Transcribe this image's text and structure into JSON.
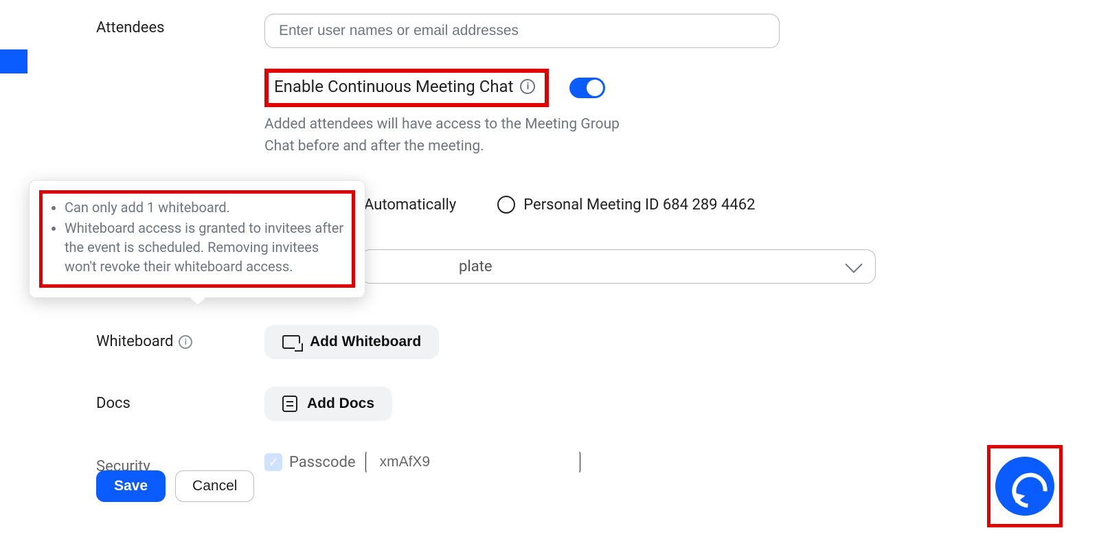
{
  "attendees": {
    "label": "Attendees",
    "placeholder": "Enter user names or email addresses"
  },
  "continuous_chat": {
    "title": "Enable Continuous Meeting Chat",
    "description": "Added attendees will have access to the Meeting Group Chat before and after the meeting.",
    "enabled": true
  },
  "meeting_id": {
    "auto_label_partial": "Automatically",
    "personal_label": "Personal Meeting ID 684 289 4462"
  },
  "template": {
    "selected_partial": "plate"
  },
  "whiteboard": {
    "label": "Whiteboard",
    "button": "Add Whiteboard",
    "tooltip_bullets": [
      "Can only add 1 whiteboard.",
      "Whiteboard access is granted to invitees after the event is scheduled. Removing invitees won't revoke their whiteboard access."
    ]
  },
  "docs": {
    "label": "Docs",
    "button": "Add Docs"
  },
  "security": {
    "label": "Security",
    "passcode_label": "Passcode",
    "passcode_value": "xmAfX9"
  },
  "actions": {
    "save": "Save",
    "cancel": "Cancel"
  }
}
